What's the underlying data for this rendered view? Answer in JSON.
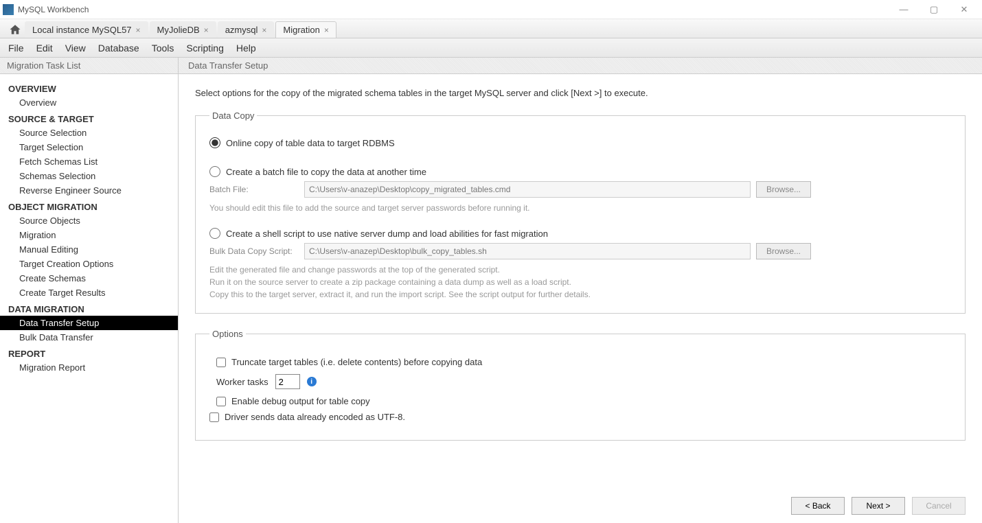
{
  "window": {
    "title": "MySQL Workbench"
  },
  "tabs": [
    {
      "label": "Local instance MySQL57"
    },
    {
      "label": "MyJolieDB"
    },
    {
      "label": "azmysql"
    },
    {
      "label": "Migration",
      "active": true
    }
  ],
  "menu": {
    "file": "File",
    "edit": "Edit",
    "view": "View",
    "database": "Database",
    "tools": "Tools",
    "scripting": "Scripting",
    "help": "Help"
  },
  "sidebar": {
    "title": "Migration Task List",
    "sections": [
      {
        "title": "OVERVIEW",
        "items": [
          {
            "label": "Overview"
          }
        ]
      },
      {
        "title": "SOURCE & TARGET",
        "items": [
          {
            "label": "Source Selection"
          },
          {
            "label": "Target Selection"
          },
          {
            "label": "Fetch Schemas List"
          },
          {
            "label": "Schemas Selection"
          },
          {
            "label": "Reverse Engineer Source"
          }
        ]
      },
      {
        "title": "OBJECT MIGRATION",
        "items": [
          {
            "label": "Source Objects"
          },
          {
            "label": "Migration"
          },
          {
            "label": "Manual Editing"
          },
          {
            "label": "Target Creation Options"
          },
          {
            "label": "Create Schemas"
          },
          {
            "label": "Create Target Results"
          }
        ]
      },
      {
        "title": "DATA MIGRATION",
        "items": [
          {
            "label": "Data Transfer Setup",
            "selected": true
          },
          {
            "label": "Bulk Data Transfer"
          }
        ]
      },
      {
        "title": "REPORT",
        "items": [
          {
            "label": "Migration Report"
          }
        ]
      }
    ]
  },
  "main": {
    "header": "Data Transfer Setup",
    "intro": "Select options for the copy of the migrated schema tables in the target MySQL server and click [Next >] to execute.",
    "group_data": {
      "legend": "Data Copy",
      "opt1": "Online copy of table data to target RDBMS",
      "opt2": "Create a batch file to copy the data at another time",
      "batch_label": "Batch File:",
      "batch_value": "C:\\Users\\v-anazep\\Desktop\\copy_migrated_tables.cmd",
      "batch_hint": "You should edit this file to add the source and target server passwords before running it.",
      "opt3": "Create a shell script to use native server dump and load abilities for fast migration",
      "bulk_label": "Bulk Data Copy Script:",
      "bulk_value": "C:\\Users\\v-anazep\\Desktop\\bulk_copy_tables.sh",
      "bulk_hint": "Edit the generated file and change passwords at the top of the generated script.\nRun it on the source server to create a zip package containing a data dump as well as a load script.\nCopy this to the target server, extract it, and run the import script. See the script output for further details.",
      "browse": "Browse..."
    },
    "group_options": {
      "legend": "Options",
      "truncate": "Truncate target tables (i.e. delete contents) before copying data",
      "worker_label": "Worker tasks",
      "worker_value": "2",
      "debug": "Enable debug output for table copy",
      "utf8": "Driver sends data already encoded as UTF-8."
    },
    "buttons": {
      "back": "< Back",
      "next": "Next >",
      "cancel": "Cancel"
    }
  }
}
